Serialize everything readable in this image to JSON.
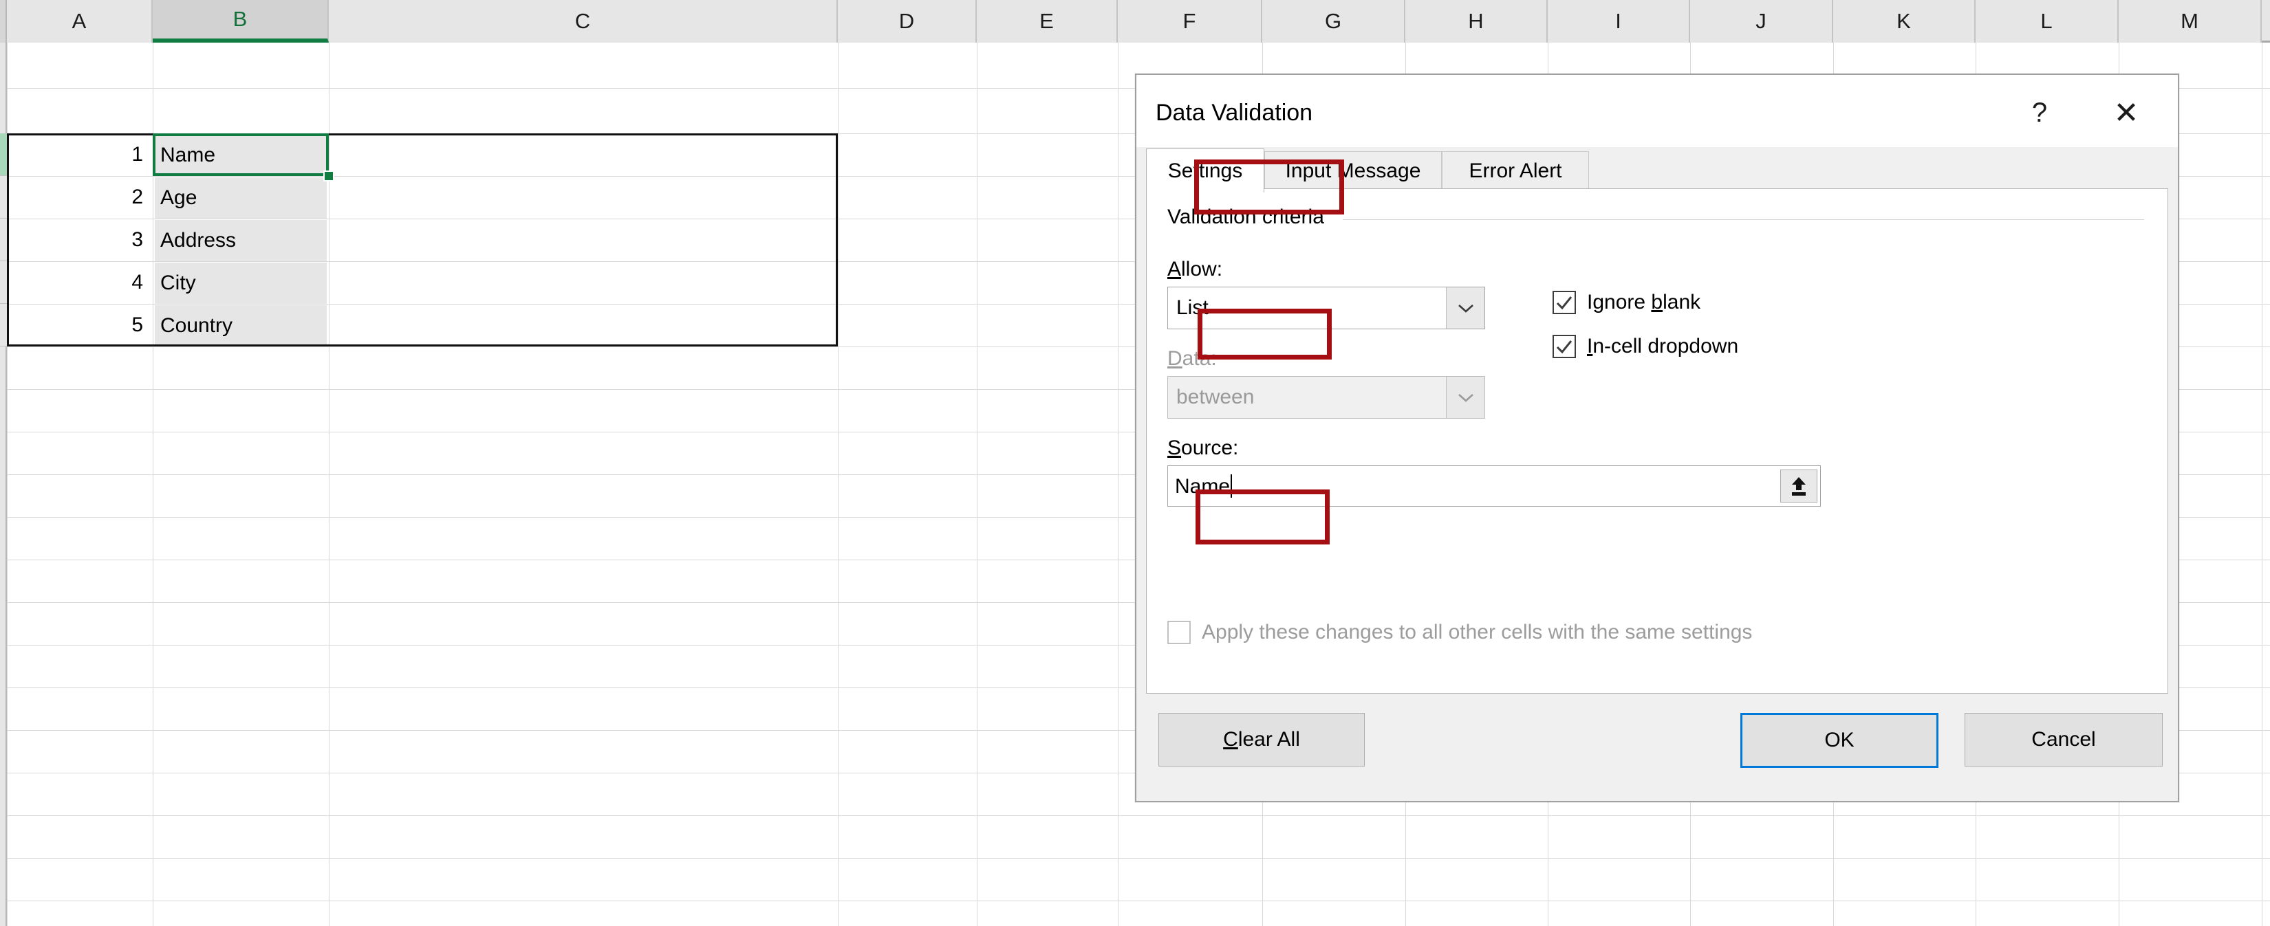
{
  "spreadsheet": {
    "column_headers": [
      "A",
      "B",
      "C",
      "D",
      "E",
      "F",
      "G",
      "H",
      "I",
      "J",
      "K",
      "L",
      "M"
    ],
    "selected_column": "B",
    "row_numbers": [
      "1",
      "2",
      "3",
      "4",
      "5"
    ],
    "column_b_values": [
      "Name",
      "Age",
      "Address",
      "City",
      "Country"
    ],
    "active_cell": "B1",
    "selected_range": "B1:C5"
  },
  "dialog": {
    "title": "Data Validation",
    "help_icon": "question-mark-icon",
    "close_icon": "close-x-icon",
    "tabs": [
      {
        "label": "Settings",
        "active": true
      },
      {
        "label": "Input Message",
        "active": false
      },
      {
        "label": "Error Alert",
        "active": false
      }
    ],
    "group_title": "Validation criteria",
    "allow": {
      "label_prefix": "A",
      "label_rest": "llow:",
      "value": "List",
      "arrow_icon": "chevron-down-icon"
    },
    "data": {
      "label_prefix": "D",
      "label_rest": "ata:",
      "value": "between",
      "arrow_icon": "chevron-down-icon",
      "disabled": true
    },
    "source": {
      "label_prefix": "S",
      "label_rest": "ource:",
      "value": "Name",
      "range_icon": "collapse-range-icon"
    },
    "checkboxes": [
      {
        "label_a": "Ignore ",
        "label_u": "b",
        "label_b": "lank",
        "checked": true,
        "disabled": false
      },
      {
        "label_a": "",
        "label_u": "I",
        "label_b": "n-cell dropdown",
        "checked": true,
        "disabled": false
      }
    ],
    "apply_all": {
      "label": "Apply these changes to all other cells with the same settings",
      "checked": false,
      "disabled": true
    },
    "buttons": {
      "clear_all_u": "C",
      "clear_all_rest": "lear All",
      "ok": "OK",
      "cancel": "Cancel"
    }
  },
  "annotations": {
    "count": 3,
    "color": "#a50f13",
    "targets": [
      "settings-tab",
      "allow-combo-value",
      "source-input-value"
    ]
  }
}
